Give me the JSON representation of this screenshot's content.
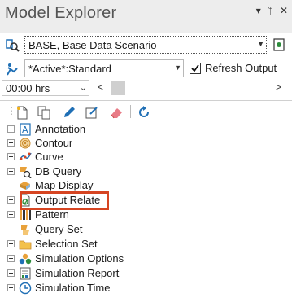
{
  "window": {
    "title": "Model Explorer",
    "controls": [
      "▾",
      "ᛘ",
      "✕"
    ]
  },
  "scenario": {
    "value": "BASE, Base Data Scenario"
  },
  "active": {
    "value": "*Active*:Standard",
    "refresh_label": "Refresh Output",
    "refresh_checked": true
  },
  "time": {
    "value": "00:00 hrs",
    "prev": "<",
    "next": ">"
  },
  "tree": {
    "items": [
      {
        "label": "Annotation",
        "expandable": true
      },
      {
        "label": "Contour",
        "expandable": true
      },
      {
        "label": "Curve",
        "expandable": true
      },
      {
        "label": "DB Query",
        "expandable": true
      },
      {
        "label": "Map Display",
        "expandable": false
      },
      {
        "label": "Output Relate",
        "expandable": true
      },
      {
        "label": "Pattern",
        "expandable": true
      },
      {
        "label": "Query Set",
        "expandable": false
      },
      {
        "label": "Selection Set",
        "expandable": true
      },
      {
        "label": "Simulation Options",
        "expandable": true
      },
      {
        "label": "Simulation Report",
        "expandable": true
      },
      {
        "label": "Simulation Time",
        "expandable": true
      }
    ]
  },
  "colors": {
    "highlight": "#d64522",
    "accent": "#1f6fb5"
  }
}
